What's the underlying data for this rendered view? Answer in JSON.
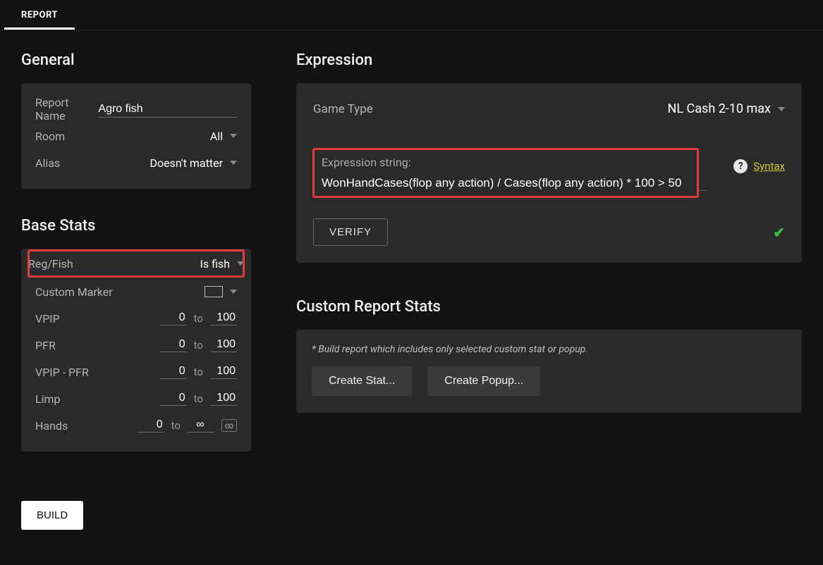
{
  "tab": {
    "report": "REPORT"
  },
  "general": {
    "heading": "General",
    "reportName": {
      "label": "Report Name",
      "value": "Agro fish"
    },
    "room": {
      "label": "Room",
      "value": "All"
    },
    "alias": {
      "label": "Alias",
      "value": "Doesn't matter"
    }
  },
  "baseStats": {
    "heading": "Base Stats",
    "regFish": {
      "label": "Reg/Fish",
      "value": "Is fish"
    },
    "customMarker": {
      "label": "Custom Marker"
    },
    "toWord": "to",
    "infinity": "∞",
    "rows": {
      "vpip": {
        "label": "VPIP",
        "from": "0",
        "to": "100"
      },
      "pfr": {
        "label": "PFR",
        "from": "0",
        "to": "100"
      },
      "vpipPfr": {
        "label": "VPIP - PFR",
        "from": "0",
        "to": "100"
      },
      "limp": {
        "label": "Limp",
        "from": "0",
        "to": "100"
      },
      "hands": {
        "label": "Hands",
        "from": "0",
        "to": "∞"
      }
    }
  },
  "expression": {
    "heading": "Expression",
    "gameType": {
      "label": "Game Type",
      "value": "NL Cash 2-10 max"
    },
    "stringLabel": "Expression string:",
    "stringValue": "WonHandCases(flop any action) / Cases(flop any action) * 100 > 50",
    "syntax": "Syntax",
    "verify": "VERIFY"
  },
  "customReport": {
    "heading": "Custom Report Stats",
    "note": "* Build report which includes only selected custom stat or popup.",
    "createStat": "Create Stat...",
    "createPopup": "Create Popup..."
  },
  "buttons": {
    "build": "BUILD"
  }
}
